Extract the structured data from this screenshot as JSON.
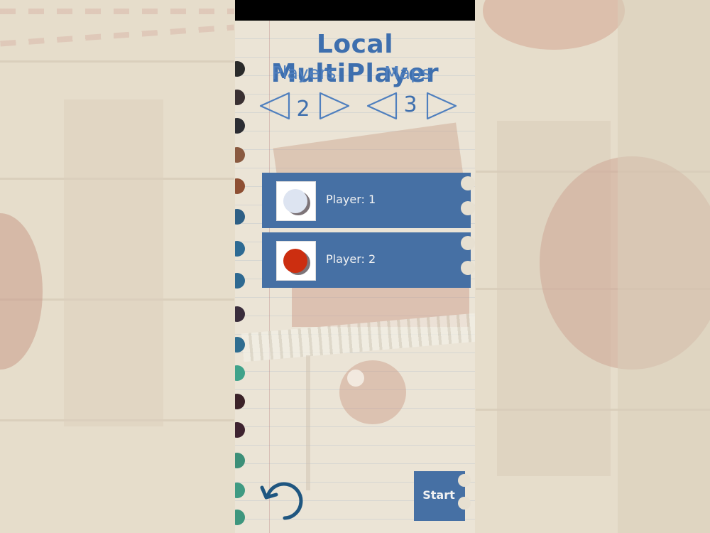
{
  "screen": {
    "title": "Local MultiPlayer",
    "players_label": "Players",
    "maps_label": "Maps",
    "players_count": "2",
    "maps_count": "3"
  },
  "players": [
    {
      "label": "Player: 1",
      "ball_color": "#dde4f1"
    },
    {
      "label": "Player: 2",
      "ball_color": "#cc2e10"
    }
  ],
  "buttons": {
    "start_label": "Start",
    "back_icon": "undo-arrow-icon"
  },
  "colors": {
    "accent": "#3e6fae",
    "card": "#4670a4",
    "paper": "#ebe4d6"
  }
}
